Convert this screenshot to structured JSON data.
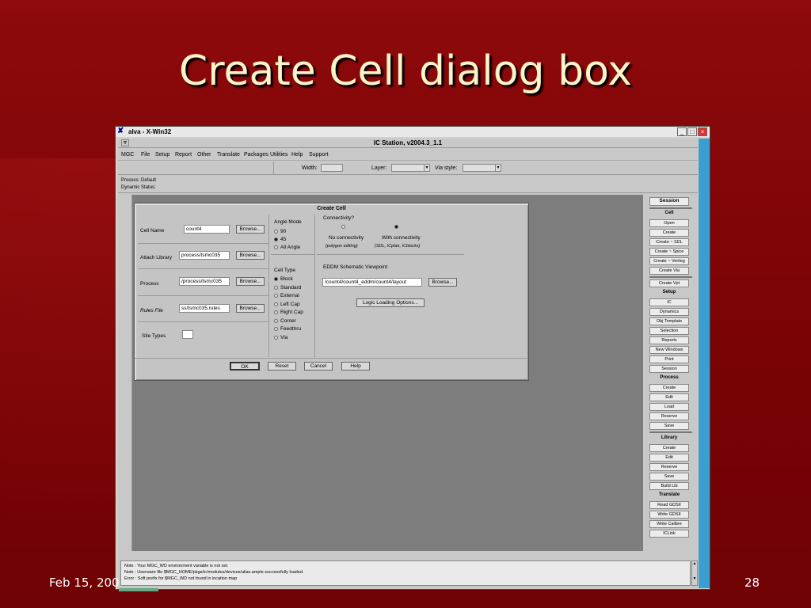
{
  "slide": {
    "title": "Create Cell dialog box",
    "footer_date": "Feb 15, 200",
    "page_number": "28"
  },
  "window": {
    "title": "alva - X-Win32",
    "app_title": "IC Station, v2004.3_1.1",
    "minimize": "_",
    "maximize": "□",
    "close": "×",
    "sys_menu": "▿"
  },
  "menu": [
    "MGC",
    "File",
    "Setup",
    "Report",
    "Other",
    "Translate",
    "Packages",
    "Utilities",
    "Help",
    "Support"
  ],
  "toolbar": {
    "width_label": "Width:",
    "layer_label": "Layer:",
    "via_style_label": "Via style:"
  },
  "status": {
    "process": "Process: Default",
    "dynamic": "Dynamic Status:"
  },
  "palette": {
    "session_title": "Session",
    "cell_head": "Cell",
    "cell_items": [
      "Open",
      "Create",
      "Create ~ SDL",
      "Create ~ Spice",
      "Create ~ Verilog",
      "Create Via"
    ],
    "create_vpt": "Create Vpt",
    "setup_head": "Setup",
    "setup_items": [
      "IC",
      "Dynamics",
      "Obj Template",
      "Selection",
      "Reports",
      "New Windows",
      "Print",
      "Session"
    ],
    "process_head": "Process",
    "process_items": [
      "Create",
      "Edit",
      "Load",
      "Reserve",
      "Save"
    ],
    "library_head": "Library",
    "library_items": [
      "Create",
      "Edit",
      "Reserve",
      "Save",
      "Build Lib"
    ],
    "translate_head": "Translate",
    "translate_items": [
      "Read GDSII",
      "Write GDSII",
      "Write Calibre",
      "ICLink"
    ]
  },
  "messages": [
    "Note : Your MGC_WD environment variable is not set.",
    "Note : Userware file $MGC_HOME/pkgs/ic/modules/devices/alias.ample successfully loaded.",
    "Error : Soft prefix for $MGC_WD not found in location map"
  ],
  "dialog": {
    "title": "Create Cell",
    "cell_name_label": "Cell Name",
    "cell_name_value": "count4",
    "attach_library_label": "Attach Library",
    "attach_library_value": "process/tsmc035",
    "process_label": "Process",
    "process_value": "/process/tsmc035",
    "rules_file_label": "Rules File",
    "rules_file_value": "ss/tsmc035.rules",
    "site_types_label": "Site Types",
    "browse_label": "Browse...",
    "angle_mode_label": "Angle Mode",
    "angle_options": [
      "90",
      "45",
      "All Angle"
    ],
    "angle_selected": 1,
    "cell_type_label": "Cell Type",
    "cell_type_options": [
      "Block",
      "Standard",
      "External",
      "Left Cap",
      "Right Cap",
      "Corner",
      "Feedthru",
      "Via"
    ],
    "cell_type_selected": 0,
    "connectivity_label": "Connectivity?",
    "no_connectivity": "No connectivity",
    "no_connectivity_note": "(polygon editing)",
    "with_connectivity": "With connectivity",
    "with_connectivity_note": "(SDL, ICplan, ICblocks)",
    "eddm_label": "EDDM Schematic Viewpoint",
    "eddm_value": "/count4/count4_eddm/count4/layout",
    "logic_loading_label": "Logic Loading Options...",
    "ok_label": "OK",
    "reset_label": "Reset",
    "cancel_label": "Cancel",
    "help_label": "Help"
  }
}
